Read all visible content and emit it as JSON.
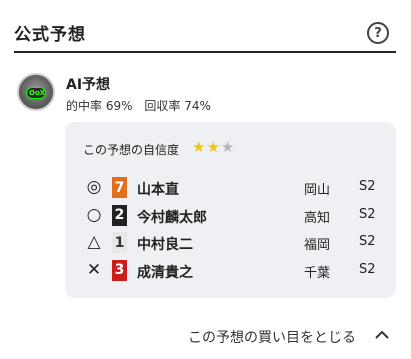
{
  "header": {
    "title": "公式予想",
    "help_label": "?"
  },
  "ai": {
    "title": "AI予想",
    "avatar_text": "OoX",
    "hit_rate_label": "的中率",
    "hit_rate_value": "69%",
    "return_rate_label": "回収率",
    "return_rate_value": "74%"
  },
  "panel": {
    "confidence_label": "この予想の自信度",
    "stars_filled": 2,
    "stars_total": 3,
    "rows": [
      {
        "mark": "◎",
        "number": "7",
        "number_bg": "#e0701f",
        "number_color": "#ffffff",
        "name": "山本直",
        "place": "岡山",
        "class": "S2"
      },
      {
        "mark": "○",
        "number": "2",
        "number_bg": "#222222",
        "number_color": "#ffffff",
        "name": "今村麟太郎",
        "place": "高知",
        "class": "S2"
      },
      {
        "mark": "△",
        "number": "1",
        "number_bg": "#e8e8e8",
        "number_color": "#333333",
        "name": "中村良二",
        "place": "福岡",
        "class": "S2"
      },
      {
        "mark": "✕",
        "number": "3",
        "number_bg": "#cc1d1d",
        "number_color": "#ffffff",
        "name": "成清貴之",
        "place": "千葉",
        "class": "S2"
      }
    ]
  },
  "footer": {
    "collapse_label": "この予想の買い目をとじる"
  }
}
